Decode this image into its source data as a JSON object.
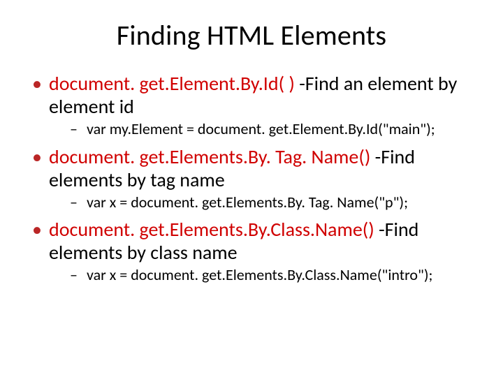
{
  "title": "Finding HTML Elements",
  "items": [
    {
      "method": "document. get.Element.By.Id( )",
      "suffix": "   -Find an element by element id",
      "example": "var  my.Element = document. get.Element.By.Id(\"main\");"
    },
    {
      "method": "document. get.Elements.By. Tag. Name()",
      "suffix": " -Find elements by tag name",
      "example": "var x = document. get.Elements.By. Tag. Name(\"p\");"
    },
    {
      "method": "document. get.Elements.By.Class.Name()",
      "suffix": " -Find elements by class name",
      "example": "var x = document. get.Elements.By.Class.Name(\"intro\");"
    }
  ]
}
